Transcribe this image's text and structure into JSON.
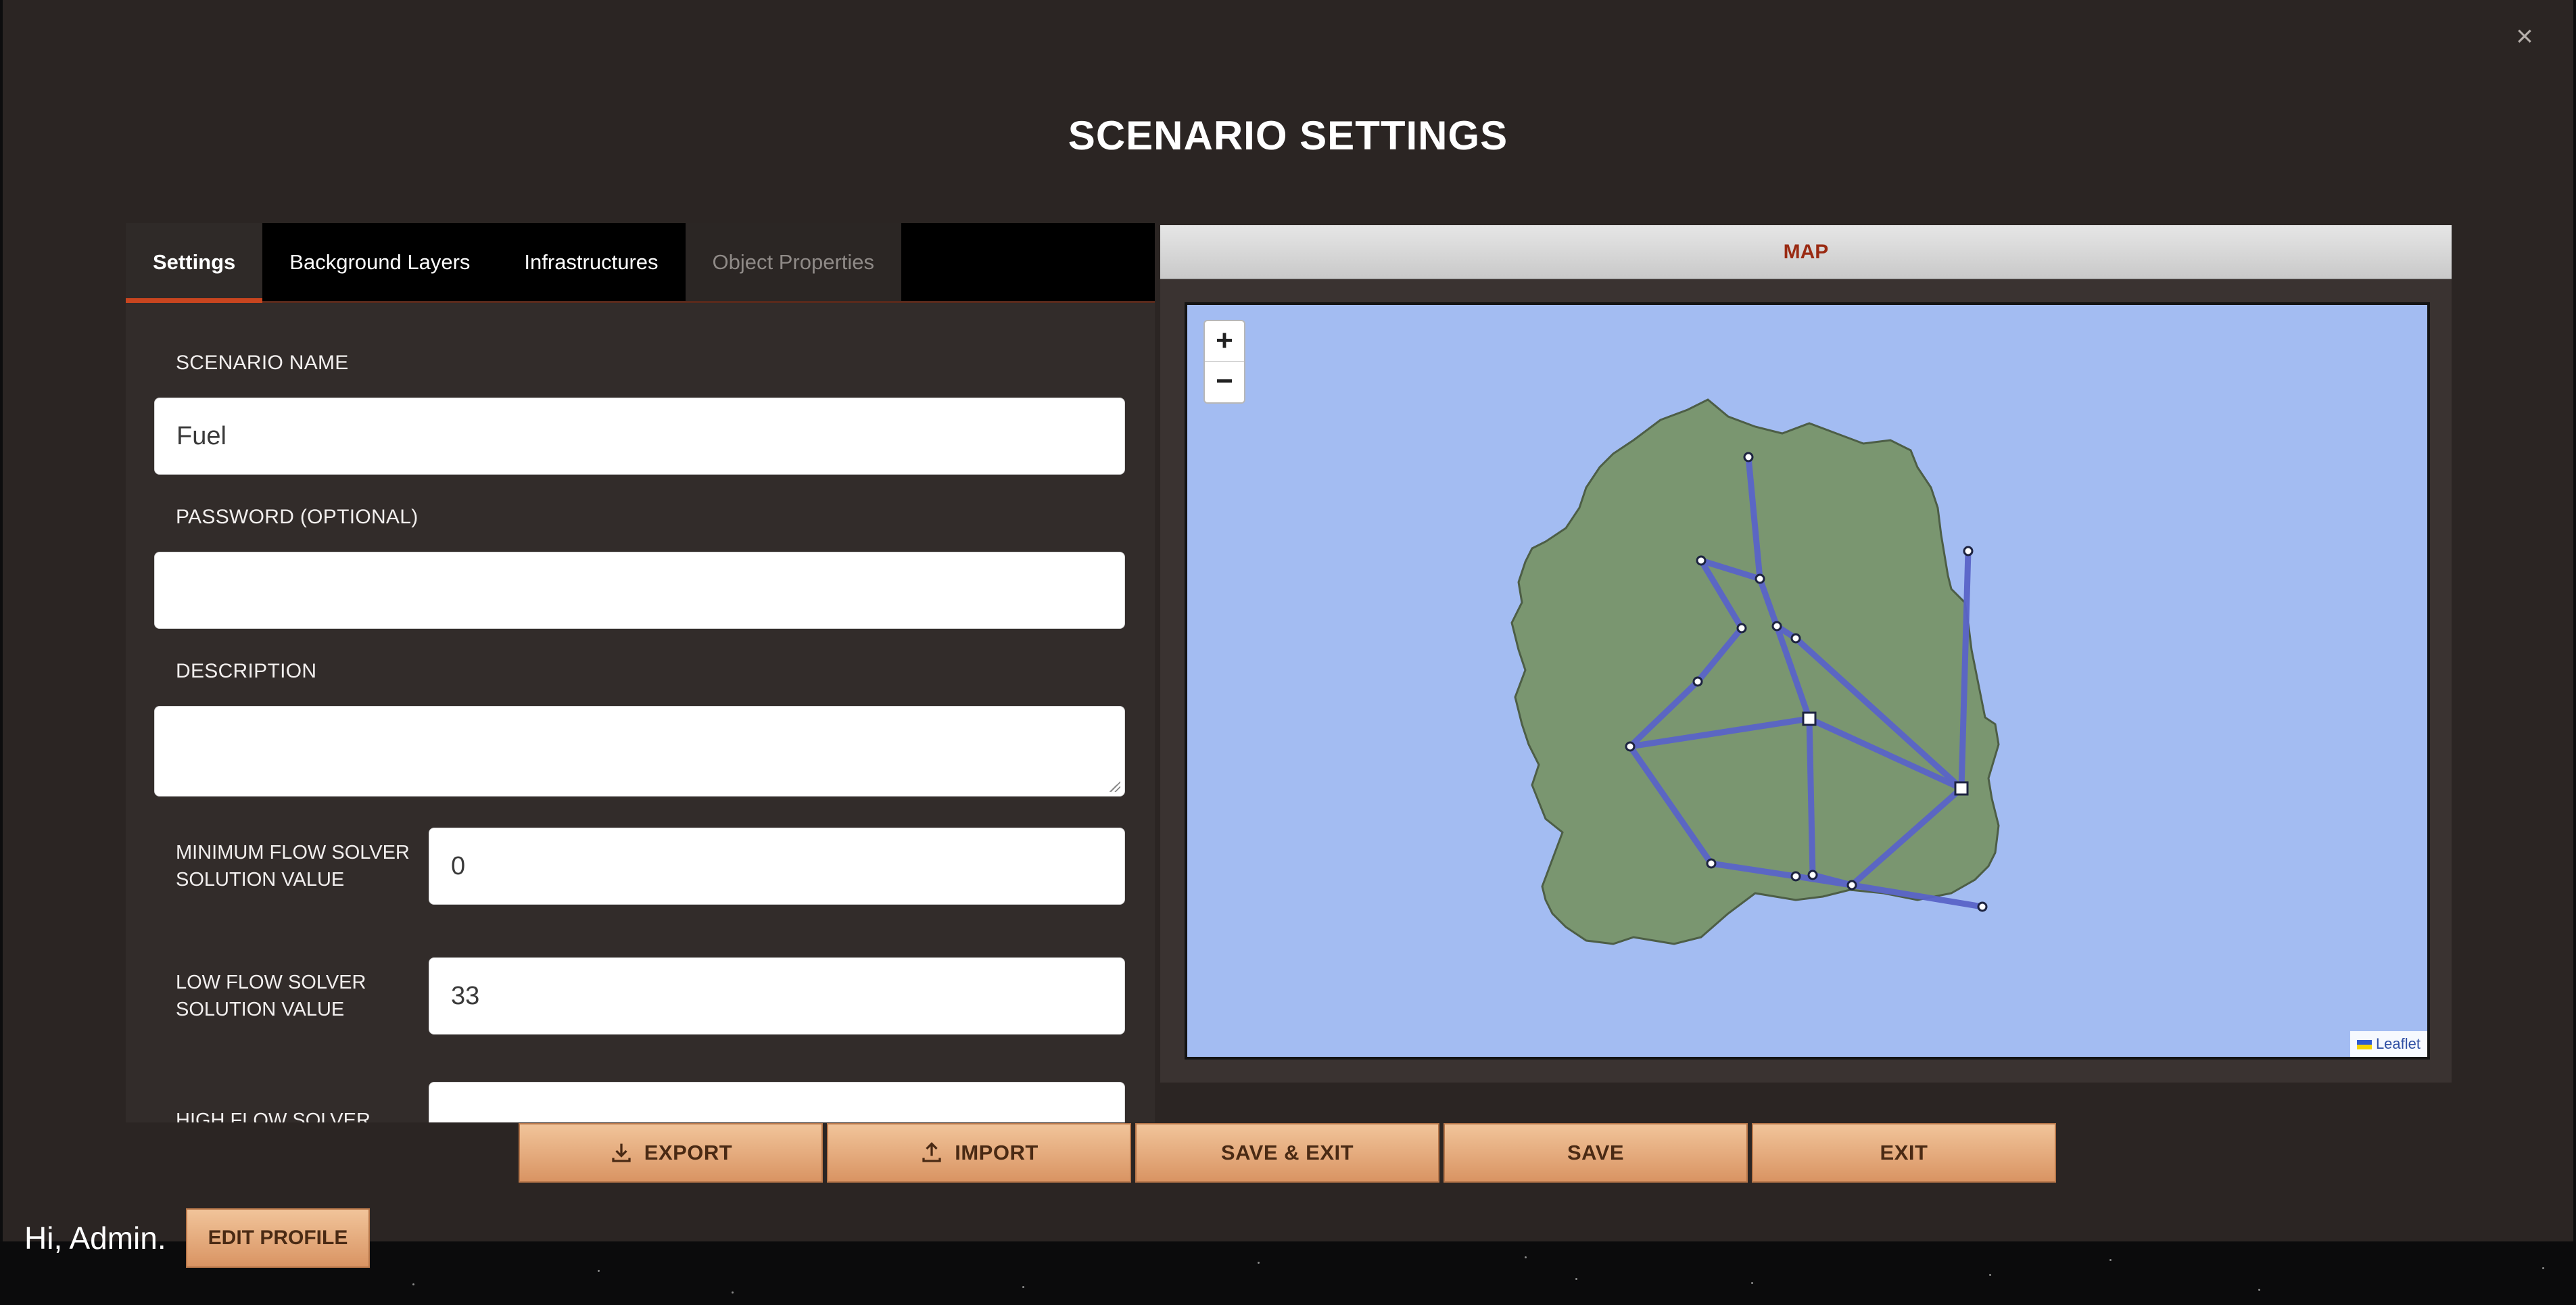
{
  "modal": {
    "title": "SCENARIO SETTINGS",
    "close_icon": "close-icon"
  },
  "tabs": [
    {
      "label": "Settings",
      "state": "active"
    },
    {
      "label": "Background Layers",
      "state": "normal"
    },
    {
      "label": "Infrastructures",
      "state": "normal"
    },
    {
      "label": "Object Properties",
      "state": "disabled"
    }
  ],
  "form": {
    "scenario_name_label": "SCENARIO NAME",
    "scenario_name_value": "Fuel",
    "password_label": "PASSWORD (OPTIONAL)",
    "password_value": "",
    "description_label": "DESCRIPTION",
    "description_value": "",
    "min_flow_label": "MINIMUM FLOW SOLVER SOLUTION VALUE",
    "min_flow_value": "0",
    "low_flow_label": "LOW FLOW SOLVER SOLUTION VALUE",
    "low_flow_value": "33",
    "high_flow_label_partial": "HIGH FLOW SOLVER"
  },
  "map": {
    "header": "MAP",
    "zoom_in": "+",
    "zoom_out": "−",
    "attribution": "Leaflet",
    "land_color": "#7a9670",
    "water_color": "#a3bcf2",
    "pipe_color": "#5a64c8"
  },
  "buttons": {
    "export": "EXPORT",
    "import": "IMPORT",
    "save_exit": "SAVE & EXIT",
    "save": "SAVE",
    "exit": "EXIT"
  },
  "user": {
    "greeting": "Hi, Admin.",
    "edit_profile": "EDIT PROFILE"
  }
}
